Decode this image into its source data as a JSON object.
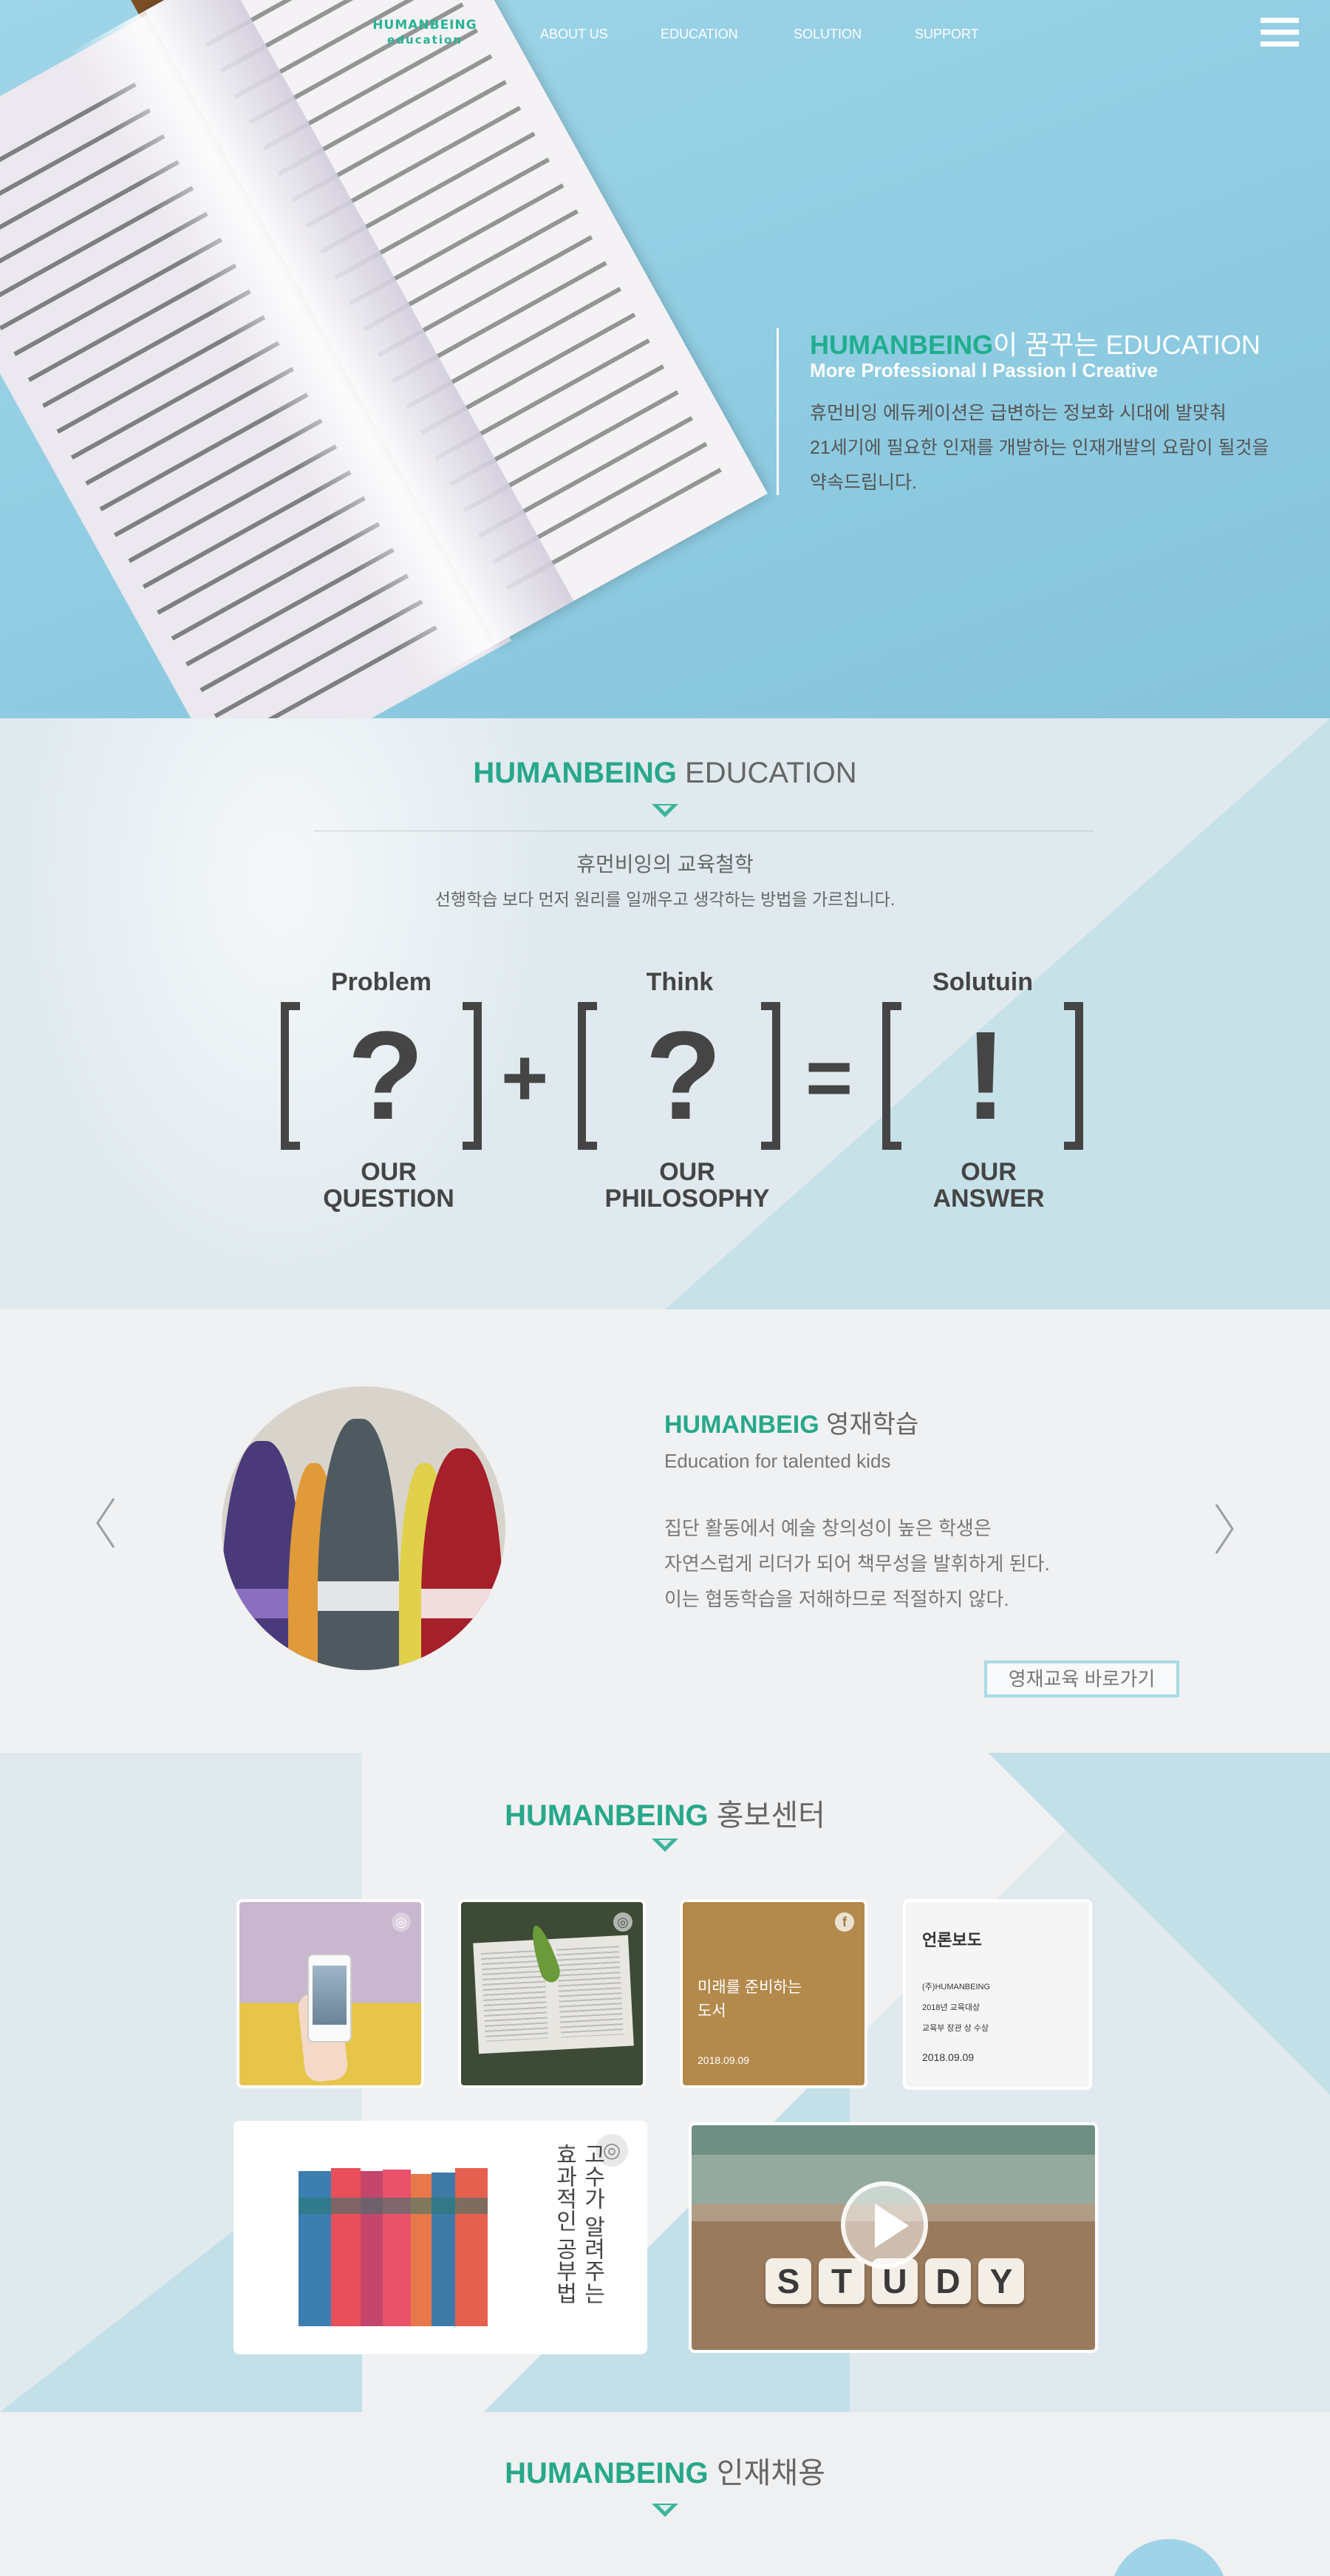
{
  "nav": {
    "logo_line1": "HUMANBEING",
    "logo_line2": "education",
    "items": [
      "ABOUT US",
      "EDUCATION",
      "SOLUTION",
      "SUPPORT"
    ]
  },
  "hero": {
    "title_accent": "HUMANBEING",
    "title_rest": "이 꿈꾸는 EDUCATION",
    "subtitle": "More Professional l Passion l Creative",
    "desc": [
      "휴먼비잉 에듀케이션은 급변하는 정보화 시대에 발맞춰",
      "21세기에 필요한 인재를 개발하는 인재개발의 요람이 될것을",
      "약속드립니다."
    ]
  },
  "education": {
    "title_accent": "HUMANBEING",
    "title_rest": " EDUCATION",
    "philosophy_title": "휴먼비잉의 교육철학",
    "philosophy_desc": "선행학습 보다 먼저 원리를 일깨우고 생각하는 방법을 가르칩니다.",
    "columns": [
      {
        "label": "Problem",
        "glyph": "?",
        "caption1": "OUR",
        "caption2": "QUESTION"
      },
      {
        "label": "Think",
        "glyph": "?",
        "caption1": "OUR",
        "caption2": "PHILOSOPHY"
      },
      {
        "label": "Solutuin",
        "glyph": "!",
        "caption1": "OUR",
        "caption2": "ANSWER"
      }
    ],
    "op_plus": "+",
    "op_equal": "="
  },
  "gifted": {
    "title_accent": "HUMANBEIG",
    "title_rest": " 영재학습",
    "subtitle": "Education for talented kids",
    "desc": [
      "집단 활동에서 예술 창의성이 높은 학생은",
      "자연스럽게 리더가 되어 책무성을 발휘하게 된다.",
      "이는 협동학습을 저해하므로 적절하지 않다."
    ],
    "button": "영재교육 바로가기"
  },
  "pr": {
    "title_accent": "HUMANBEING",
    "title_rest": " 홍보센터",
    "card3": {
      "text1": "미래를 준비하는",
      "text2": "도서",
      "date": "2018.09.09",
      "icon": "f"
    },
    "card4": {
      "title": "언론보도",
      "line1": "(주)HUMANBEING",
      "line2": "2018년 교육대상",
      "line3": "교육부 장관 상 수상",
      "date": "2018.09.09"
    },
    "books_text": [
      "고수가 알려주는",
      "효과적인 공부법"
    ],
    "dice_letters": [
      "S",
      "T",
      "U",
      "D",
      "Y"
    ]
  },
  "recruit": {
    "title_accent": "HUMANBEING",
    "title_rest": " 인재채용"
  },
  "colors": {
    "accent": "#27a88a",
    "hero_bg": "#8fcce2",
    "brown_card": "#b38a4c",
    "button_border": "#a9dbe6"
  },
  "icons": [
    "hamburger-menu-icon",
    "chevron-left-icon",
    "chevron-right-icon",
    "instagram-icon",
    "facebook-icon",
    "play-icon"
  ]
}
